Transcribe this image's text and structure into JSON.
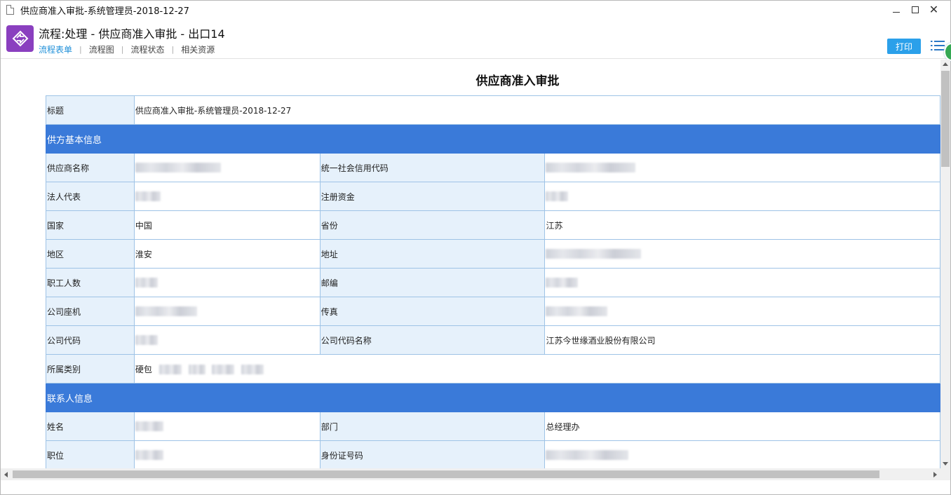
{
  "window": {
    "title": "供应商准入审批-系统管理员-2018-12-27"
  },
  "header": {
    "title": "流程:处理 - 供应商准入审批 - 出口14",
    "tabs": [
      {
        "label": "流程表单",
        "active": true
      },
      {
        "label": "流程图",
        "active": false
      },
      {
        "label": "流程状态",
        "active": false
      },
      {
        "label": "相关资源",
        "active": false
      }
    ],
    "print_label": "打印"
  },
  "form": {
    "title": "供应商准入审批",
    "subject_label": "标题",
    "subject_value": "供应商准入审批-系统管理员-2018-12-27",
    "section_supplier": "供方基本信息",
    "section_contact": "联系人信息",
    "supplier_fields": {
      "name_label": "供应商名称",
      "credit_code_label": "统一社会信用代码",
      "legal_rep_label": "法人代表",
      "capital_label": "注册资金",
      "country_label": "国家",
      "country_value": "中国",
      "province_label": "省份",
      "province_value": "江苏",
      "region_label": "地区",
      "region_value": "淮安",
      "address_label": "地址",
      "employees_label": "职工人数",
      "postcode_label": "邮编",
      "phone_label": "公司座机",
      "fax_label": "传真",
      "company_code_label": "公司代码",
      "company_code_name_label": "公司代码名称",
      "company_code_name_value": "江苏今世缘酒业股份有限公司",
      "category_label": "所属类别",
      "category_value": "硬包"
    },
    "contact_fields": {
      "name_label": "姓名",
      "dept_label": "部门",
      "dept_value": "总经理办",
      "position_label": "职位",
      "id_label": "身份证号码"
    }
  },
  "colors": {
    "section_bg": "#3a7ad9",
    "label_bg": "#e6f1fb",
    "border": "#9ec3e6",
    "accent": "#2ba0ea",
    "logo_bg": "#8a3fbf"
  }
}
